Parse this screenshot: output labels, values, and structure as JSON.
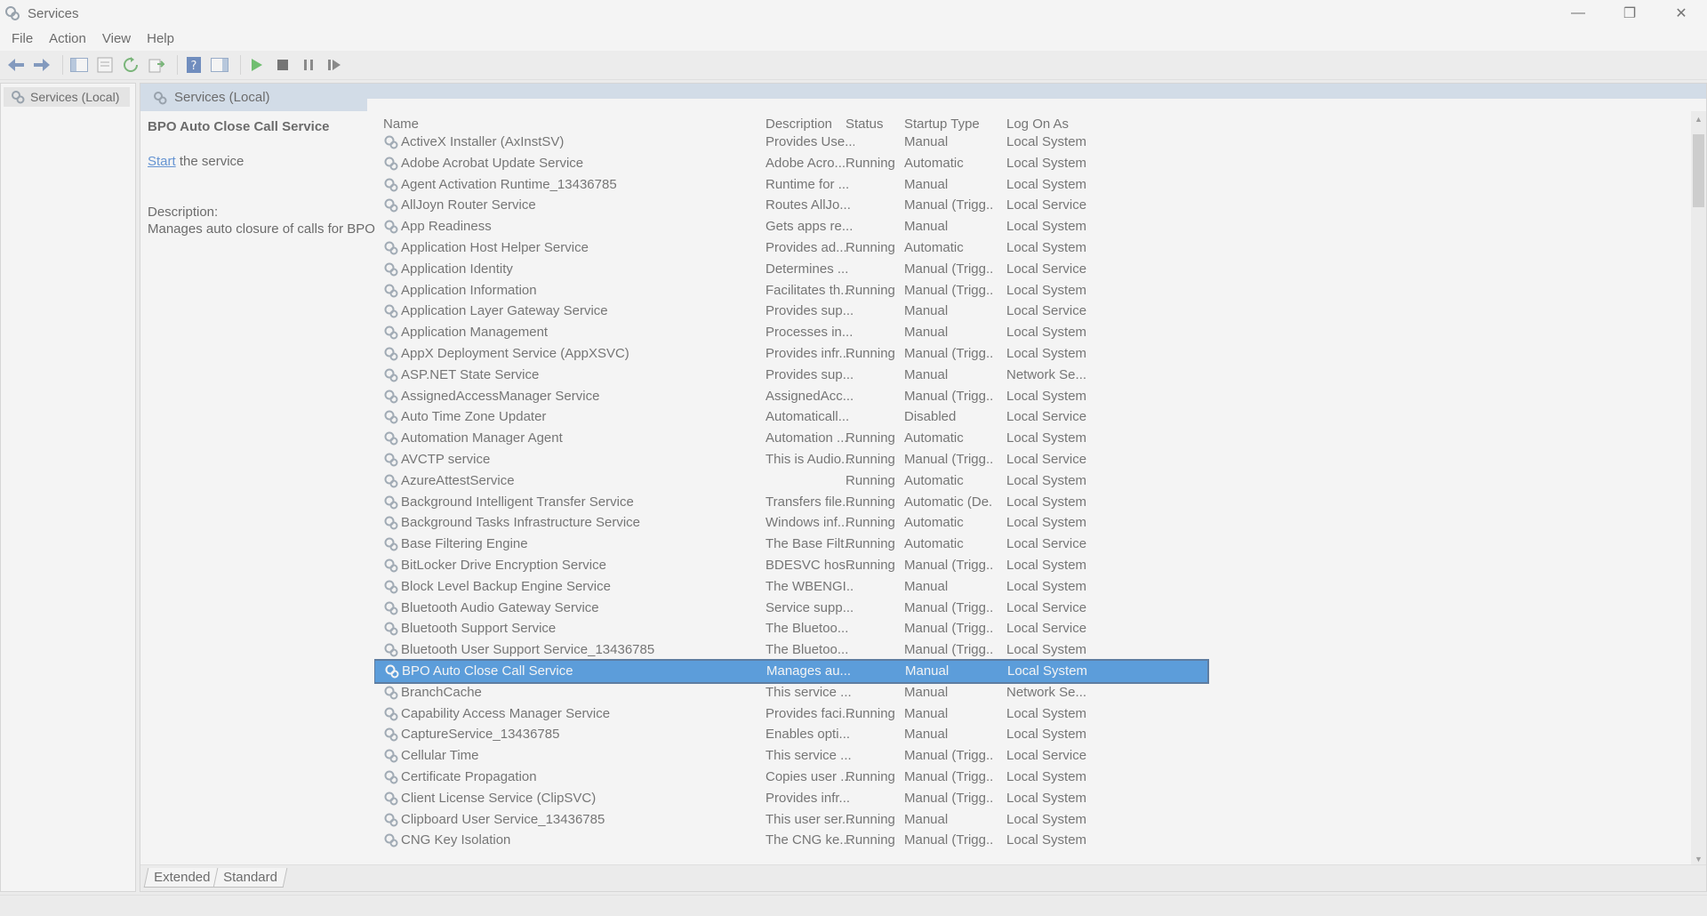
{
  "window": {
    "title": "Services"
  },
  "menu": [
    "File",
    "Action",
    "View",
    "Help"
  ],
  "tree": {
    "root": "Services (Local)"
  },
  "pane": {
    "header": "Services (Local)"
  },
  "details": {
    "title": "BPO Auto Close Call Service",
    "start_link": "Start",
    "start_suffix": " the service",
    "desc_label": "Description:",
    "desc_text": "Manages auto closure of calls for BPO"
  },
  "columns": {
    "name": "Name",
    "description": "Description",
    "status": "Status",
    "startup": "Startup Type",
    "logon": "Log On As"
  },
  "services": [
    {
      "name": "ActiveX Installer (AxInstSV)",
      "desc": "Provides Use...",
      "status": "",
      "startup": "Manual",
      "logon": "Local System"
    },
    {
      "name": "Adobe Acrobat Update Service",
      "desc": "Adobe Acro...",
      "status": "Running",
      "startup": "Automatic",
      "logon": "Local System"
    },
    {
      "name": "Agent Activation Runtime_13436785",
      "desc": "Runtime for ...",
      "status": "",
      "startup": "Manual",
      "logon": "Local System"
    },
    {
      "name": "AllJoyn Router Service",
      "desc": "Routes AllJo...",
      "status": "",
      "startup": "Manual (Trigg...",
      "logon": "Local Service"
    },
    {
      "name": "App Readiness",
      "desc": "Gets apps re...",
      "status": "",
      "startup": "Manual",
      "logon": "Local System"
    },
    {
      "name": "Application Host Helper Service",
      "desc": "Provides ad...",
      "status": "Running",
      "startup": "Automatic",
      "logon": "Local System"
    },
    {
      "name": "Application Identity",
      "desc": "Determines ...",
      "status": "",
      "startup": "Manual (Trigg...",
      "logon": "Local Service"
    },
    {
      "name": "Application Information",
      "desc": "Facilitates th...",
      "status": "Running",
      "startup": "Manual (Trigg...",
      "logon": "Local System"
    },
    {
      "name": "Application Layer Gateway Service",
      "desc": "Provides sup...",
      "status": "",
      "startup": "Manual",
      "logon": "Local Service"
    },
    {
      "name": "Application Management",
      "desc": "Processes in...",
      "status": "",
      "startup": "Manual",
      "logon": "Local System"
    },
    {
      "name": "AppX Deployment Service (AppXSVC)",
      "desc": "Provides infr...",
      "status": "Running",
      "startup": "Manual (Trigg...",
      "logon": "Local System"
    },
    {
      "name": "ASP.NET State Service",
      "desc": "Provides sup...",
      "status": "",
      "startup": "Manual",
      "logon": "Network Se..."
    },
    {
      "name": "AssignedAccessManager Service",
      "desc": "AssignedAcc...",
      "status": "",
      "startup": "Manual (Trigg...",
      "logon": "Local System"
    },
    {
      "name": "Auto Time Zone Updater",
      "desc": "Automaticall...",
      "status": "",
      "startup": "Disabled",
      "logon": "Local Service"
    },
    {
      "name": "Automation Manager Agent",
      "desc": "Automation ...",
      "status": "Running",
      "startup": "Automatic",
      "logon": "Local System"
    },
    {
      "name": "AVCTP service",
      "desc": "This is Audio...",
      "status": "Running",
      "startup": "Manual (Trigg...",
      "logon": "Local Service"
    },
    {
      "name": "AzureAttestService",
      "desc": "",
      "status": "Running",
      "startup": "Automatic",
      "logon": "Local System"
    },
    {
      "name": "Background Intelligent Transfer Service",
      "desc": "Transfers file...",
      "status": "Running",
      "startup": "Automatic (De...",
      "logon": "Local System"
    },
    {
      "name": "Background Tasks Infrastructure Service",
      "desc": "Windows inf...",
      "status": "Running",
      "startup": "Automatic",
      "logon": "Local System"
    },
    {
      "name": "Base Filtering Engine",
      "desc": "The Base Filt...",
      "status": "Running",
      "startup": "Automatic",
      "logon": "Local Service"
    },
    {
      "name": "BitLocker Drive Encryption Service",
      "desc": "BDESVC hos...",
      "status": "Running",
      "startup": "Manual (Trigg...",
      "logon": "Local System"
    },
    {
      "name": "Block Level Backup Engine Service",
      "desc": "The WBENGI...",
      "status": "",
      "startup": "Manual",
      "logon": "Local System"
    },
    {
      "name": "Bluetooth Audio Gateway Service",
      "desc": "Service supp...",
      "status": "",
      "startup": "Manual (Trigg...",
      "logon": "Local Service"
    },
    {
      "name": "Bluetooth Support Service",
      "desc": "The Bluetoo...",
      "status": "",
      "startup": "Manual (Trigg...",
      "logon": "Local Service"
    },
    {
      "name": "Bluetooth User Support Service_13436785",
      "desc": "The Bluetoo...",
      "status": "",
      "startup": "Manual (Trigg...",
      "logon": "Local System"
    },
    {
      "name": "BPO Auto Close Call Service",
      "desc": "Manages au...",
      "status": "",
      "startup": "Manual",
      "logon": "Local System",
      "selected": true
    },
    {
      "name": "BranchCache",
      "desc": "This service ...",
      "status": "",
      "startup": "Manual",
      "logon": "Network Se..."
    },
    {
      "name": "Capability Access Manager Service",
      "desc": "Provides faci...",
      "status": "Running",
      "startup": "Manual",
      "logon": "Local System"
    },
    {
      "name": "CaptureService_13436785",
      "desc": "Enables opti...",
      "status": "",
      "startup": "Manual",
      "logon": "Local System"
    },
    {
      "name": "Cellular Time",
      "desc": "This service ...",
      "status": "",
      "startup": "Manual (Trigg...",
      "logon": "Local Service"
    },
    {
      "name": "Certificate Propagation",
      "desc": "Copies user ...",
      "status": "Running",
      "startup": "Manual (Trigg...",
      "logon": "Local System"
    },
    {
      "name": "Client License Service (ClipSVC)",
      "desc": "Provides infr...",
      "status": "",
      "startup": "Manual (Trigg...",
      "logon": "Local System"
    },
    {
      "name": "Clipboard User Service_13436785",
      "desc": "This user ser...",
      "status": "Running",
      "startup": "Manual",
      "logon": "Local System"
    },
    {
      "name": "CNG Key Isolation",
      "desc": "The CNG ke...",
      "status": "Running",
      "startup": "Manual (Trigg...",
      "logon": "Local System"
    }
  ],
  "tabs": [
    "Extended",
    "Standard"
  ],
  "colors": {
    "selection": "#0a73d6",
    "header": "#c9d8ea",
    "link": "#1a64c8"
  }
}
